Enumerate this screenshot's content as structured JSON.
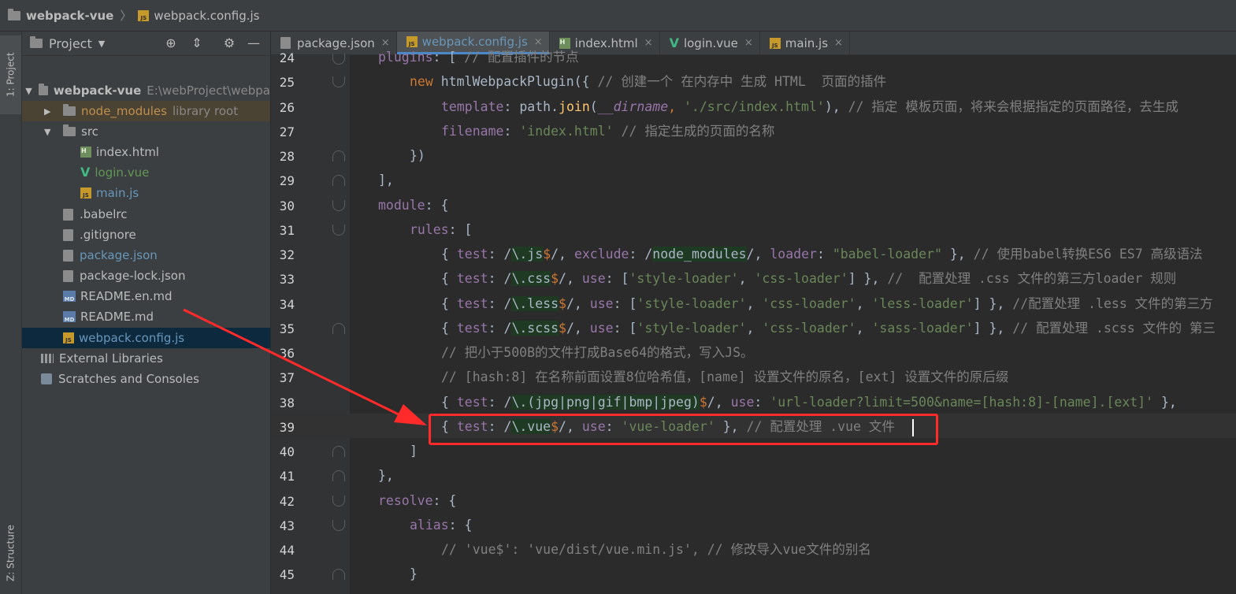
{
  "breadcrumb": {
    "project": "webpack-vue",
    "file": "webpack.config.js"
  },
  "left_strip": {
    "project_tab": "1: Project",
    "structure_tab": "Z: Structure"
  },
  "project_panel": {
    "title": "Project",
    "tree": [
      {
        "label": "webpack-vue",
        "extra": "E:\\webProject\\webpa",
        "icon": "folder-icon",
        "indent": 0,
        "arrow": "▼",
        "bold": true
      },
      {
        "label": "node_modules",
        "extra": "library root",
        "icon": "folder-icon",
        "indent": 1,
        "arrow": "▶"
      },
      {
        "label": "src",
        "icon": "folder-icon",
        "indent": 1,
        "arrow": "▼"
      },
      {
        "label": "index.html",
        "icon": "html-file-icon",
        "indent": 2
      },
      {
        "label": "login.vue",
        "icon": "vue-file-icon",
        "indent": 2
      },
      {
        "label": "main.js",
        "icon": "js-file-icon",
        "indent": 2
      },
      {
        "label": ".babelrc",
        "icon": "config-file-icon",
        "indent": 1
      },
      {
        "label": ".gitignore",
        "icon": "config-file-icon",
        "indent": 1
      },
      {
        "label": "package.json",
        "icon": "config-file-icon",
        "indent": 1
      },
      {
        "label": "package-lock.json",
        "icon": "config-file-icon",
        "indent": 1
      },
      {
        "label": "README.en.md",
        "icon": "md-file-icon",
        "indent": 1
      },
      {
        "label": "README.md",
        "icon": "md-file-icon",
        "indent": 1
      },
      {
        "label": "webpack.config.js",
        "icon": "js-file-icon",
        "indent": 1,
        "selected": true
      },
      {
        "label": "External Libraries",
        "icon": "library-icon",
        "indent": 0
      },
      {
        "label": "Scratches and Consoles",
        "icon": "scratch-icon",
        "indent": 0
      }
    ]
  },
  "tabs": [
    {
      "label": "package.json",
      "icon": "config-file-icon"
    },
    {
      "label": "webpack.config.js",
      "icon": "js-file-icon",
      "active": true
    },
    {
      "label": "index.html",
      "icon": "html-file-icon"
    },
    {
      "label": "login.vue",
      "icon": "vue-file-icon"
    },
    {
      "label": "main.js",
      "icon": "js-file-icon"
    }
  ],
  "line_numbers": [
    "24",
    "25",
    "26",
    "27",
    "28",
    "29",
    "30",
    "31",
    "32",
    "33",
    "34",
    "35",
    "36",
    "37",
    "38",
    "39",
    "40",
    "41",
    "42",
    "43",
    "44",
    "45"
  ],
  "code": {
    "l24a": "plugins",
    "l24b": ": [ ",
    "l24c": "// 配置插件的节点",
    "l25a": "new ",
    "l25b": "htmlWebpackPlugin",
    "l25c": "({ ",
    "l25d": "// 创建一个 在内存中 生成 HTML  页面的插件",
    "l26a": "template",
    "l26b": ": path.",
    "l26c": "join",
    "l26d": "(",
    "l26e": "__dirname",
    "l26f": ", ",
    "l26g": "'./src/index.html'",
    "l26h": "), ",
    "l26i": "// 指定 模板页面，将来会根据指定的页面路径，去生成",
    "l27a": "filename",
    "l27b": ": ",
    "l27c": "'index.html'",
    "l27d": " ",
    "l27e": "// 指定生成的页面的名称",
    "l28": "})",
    "l29": "],",
    "l30a": "module",
    "l30b": ": {",
    "l31a": "rules",
    "l31b": ": [",
    "l32a": "{ ",
    "l32b": "test",
    "l32c": ": /",
    "l32d": "\\.js",
    "l32e": "$",
    "l32f": "/, ",
    "l32g": "exclude",
    "l32h": ": /",
    "l32i": "node_modules",
    "l32j": "/, ",
    "l32k": "loader",
    "l32l": ": ",
    "l32m": "\"babel-loader\"",
    "l32n": " }, ",
    "l32o": "// 使用babel转换ES6 ES7 高级语法",
    "l33a": "{ ",
    "l33b": "test",
    "l33c": ": /",
    "l33d": "\\.css",
    "l33e": "$",
    "l33f": "/, ",
    "l33g": "use",
    "l33h": ": [",
    "l33i": "'style-loader'",
    "l33j": ", ",
    "l33k": "'css-loader'",
    "l33l": "] }, ",
    "l33m": "//  配置处理 .css 文件的第三方loader 规则",
    "l34a": "{ ",
    "l34b": "test",
    "l34c": ": /",
    "l34d": "\\.less",
    "l34e": "$",
    "l34f": "/, ",
    "l34g": "use",
    "l34h": ": [",
    "l34i": "'style-loader'",
    "l34j": ", ",
    "l34k": "'css-loader'",
    "l34l": ", ",
    "l34m": "'less-loader'",
    "l34n": "] }, ",
    "l34o": "//配置处理 .less 文件的第三方",
    "l35a": "{ ",
    "l35b": "test",
    "l35c": ": /",
    "l35d": "\\.scss",
    "l35e": "$",
    "l35f": "/, ",
    "l35g": "use",
    "l35h": ": [",
    "l35i": "'style-loader'",
    "l35j": ", ",
    "l35k": "'css-loader'",
    "l35l": ", ",
    "l35m": "'sass-loader'",
    "l35n": "] }, ",
    "l35o": "// 配置处理 .scss 文件的 第三",
    "l36": "// 把小于500B的文件打成Base64的格式，写入JS。",
    "l37": "// [hash:8] 在名称前面设置8位哈希值，[name] 设置文件的原名，[ext] 设置文件的原后缀",
    "l38a": "{ ",
    "l38b": "test",
    "l38c": ": /",
    "l38d": "\\.(jpg|png|gif|bmp|jpeg)",
    "l38e": "$",
    "l38f": "/, ",
    "l38g": "use",
    "l38h": ": ",
    "l38i": "'url-loader?limit=500&name=[hash:8]-[name].[ext]'",
    "l38j": " },",
    "l39a": "{ ",
    "l39b": "test",
    "l39c": ": /",
    "l39d": "\\.vue",
    "l39e": "$",
    "l39f": "/, ",
    "l39g": "use",
    "l39h": ": ",
    "l39i": "'vue-loader'",
    "l39j": " }, ",
    "l39k": "// 配置处理 .vue 文件",
    "l40": "]",
    "l41": "},",
    "l42a": "resolve",
    "l42b": ": {",
    "l43a": "alias",
    "l43b": ": {",
    "l44": "// 'vue$': 'vue/dist/vue.min.js', // 修改导入vue文件的别名",
    "l45": "}"
  },
  "colors": {
    "annotation": "#ff2a2a",
    "keyword": "#cc7832",
    "string": "#6a8759",
    "comment": "#808080",
    "property": "#9876aa"
  }
}
